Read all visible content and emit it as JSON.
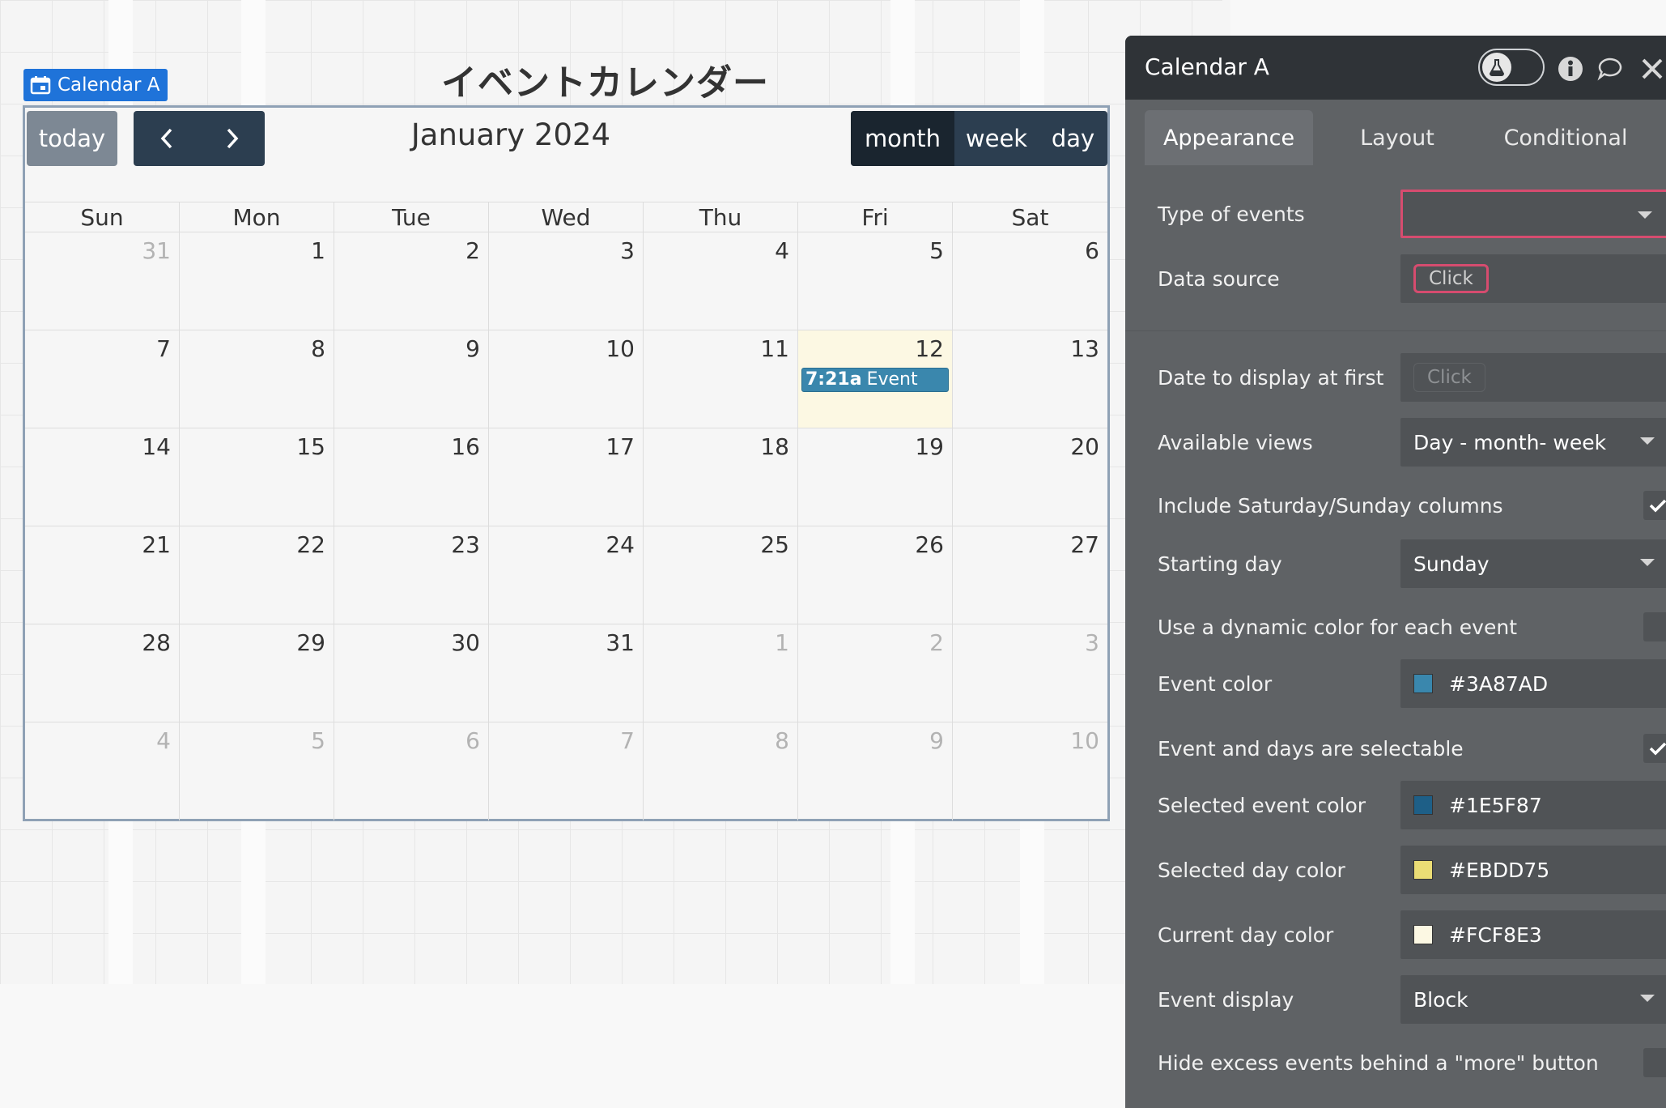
{
  "element_badge": {
    "label": "Calendar A",
    "icon": "calendar-icon"
  },
  "calendar_title": "イベントカレンダー",
  "calendar": {
    "today_label": "today",
    "prev_icon": "chevron-left-icon",
    "next_icon": "chevron-right-icon",
    "month_label": "January 2024",
    "views": [
      {
        "label": "month",
        "active": true
      },
      {
        "label": "week",
        "active": false
      },
      {
        "label": "day",
        "active": false
      }
    ],
    "weekdays": [
      "Sun",
      "Mon",
      "Tue",
      "Wed",
      "Thu",
      "Fri",
      "Sat"
    ],
    "weeks": [
      [
        {
          "n": "31",
          "other": true
        },
        {
          "n": "1"
        },
        {
          "n": "2"
        },
        {
          "n": "3"
        },
        {
          "n": "4"
        },
        {
          "n": "5"
        },
        {
          "n": "6"
        }
      ],
      [
        {
          "n": "7"
        },
        {
          "n": "8"
        },
        {
          "n": "9"
        },
        {
          "n": "10"
        },
        {
          "n": "11"
        },
        {
          "n": "12",
          "today": true,
          "event": {
            "time": "7:21a",
            "title": "Event"
          }
        },
        {
          "n": "13"
        }
      ],
      [
        {
          "n": "14"
        },
        {
          "n": "15"
        },
        {
          "n": "16"
        },
        {
          "n": "17"
        },
        {
          "n": "18"
        },
        {
          "n": "19"
        },
        {
          "n": "20"
        }
      ],
      [
        {
          "n": "21"
        },
        {
          "n": "22"
        },
        {
          "n": "23"
        },
        {
          "n": "24"
        },
        {
          "n": "25"
        },
        {
          "n": "26"
        },
        {
          "n": "27"
        }
      ],
      [
        {
          "n": "28"
        },
        {
          "n": "29"
        },
        {
          "n": "30"
        },
        {
          "n": "31"
        },
        {
          "n": "1",
          "other": true
        },
        {
          "n": "2",
          "other": true
        },
        {
          "n": "3",
          "other": true
        }
      ],
      [
        {
          "n": "4",
          "other": true
        },
        {
          "n": "5",
          "other": true
        },
        {
          "n": "6",
          "other": true
        },
        {
          "n": "7",
          "other": true
        },
        {
          "n": "8",
          "other": true
        },
        {
          "n": "9",
          "other": true
        },
        {
          "n": "10",
          "other": true
        }
      ]
    ]
  },
  "panel": {
    "title": "Calendar A",
    "header_icons": [
      "flask-icon",
      "info-icon",
      "comment-icon",
      "close-icon"
    ],
    "tabs": [
      "Appearance",
      "Layout",
      "Conditional"
    ],
    "active_tab": "Appearance",
    "props": {
      "type_of_events": {
        "label": "Type of events",
        "value": ""
      },
      "data_source": {
        "label": "Data source",
        "value": "Click"
      },
      "date_display": {
        "label": "Date to display at first",
        "value": "Click"
      },
      "available_views": {
        "label": "Available views",
        "value": "Day - month- week"
      },
      "include_weekend": {
        "label": "Include Saturday/Sunday columns",
        "checked": true
      },
      "starting_day": {
        "label": "Starting day",
        "value": "Sunday"
      },
      "dynamic_color": {
        "label": "Use a dynamic color for each event",
        "checked": false
      },
      "event_color": {
        "label": "Event color",
        "value": "#3A87AD"
      },
      "selectable": {
        "label": "Event and days are selectable",
        "checked": true
      },
      "selected_event_color": {
        "label": "Selected event color",
        "value": "#1E5F87"
      },
      "selected_day_color": {
        "label": "Selected day color",
        "value": "#EBDD75"
      },
      "current_day_color": {
        "label": "Current day color",
        "value": "#FCF8E3"
      },
      "event_display": {
        "label": "Event display",
        "value": "Block"
      },
      "hide_excess": {
        "label": "Hide excess events behind a \"more\" button",
        "checked": false
      }
    }
  },
  "colors": {
    "badge_blue": "#1F73D9",
    "nav_dark": "#2C3E50",
    "event_color": "#3A87AD",
    "current_day": "#FCF8E3",
    "panel_bg": "#5F6265",
    "error_red": "#D64C6F"
  }
}
